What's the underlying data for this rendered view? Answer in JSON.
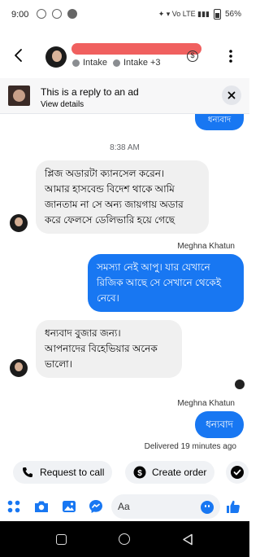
{
  "status_bar": {
    "time": "9:00",
    "battery": "56%",
    "signal_text": "Vo LTE"
  },
  "header": {
    "tags": [
      "Intake",
      "Intake +3"
    ],
    "dollar_symbol": "$"
  },
  "ad_banner": {
    "title": "This is a reply to an ad",
    "link": "View details"
  },
  "messages": {
    "top_partial": "ধন্যবাদ",
    "timestamp": "8:38 AM",
    "m1": "প্লিজ অডারটা ক্যানসেল করেন।\nআমার হাসবেন্ড বিদেশ থাকে আমি\nজানতাম না সে অন্য জায়গায় অডার\nকরে ফেলসে ডেলিভারি হয়ে গেছে",
    "sender1": "Meghna Khatun",
    "m2": "সমস্যা নেই আপু। যার যেখানে\nরিজিক আছে সে সেখানে থেকেই\nনেবে।",
    "m3": "ধন্যবাদ বুজার জন্য।\nআপনাদের বিহেভিয়ার অনেক\nভালো।",
    "sender2": "Meghna Khatun",
    "m4": "ধন্যবাদ",
    "delivered": "Delivered 19 minutes ago"
  },
  "quick_actions": {
    "request_call": "Request to call",
    "create_order": "Create order"
  },
  "composer": {
    "placeholder": "Aa"
  },
  "colors": {
    "accent": "#1877f2",
    "incoming_bubble": "#f0f0f0",
    "redaction": "#f0605f"
  },
  "icons": [
    "back-arrow-icon",
    "dollar-icon",
    "more-options-icon",
    "close-icon",
    "menu-grid-icon",
    "camera-icon",
    "photo-icon",
    "messenger-icon",
    "emoji-icon",
    "thumbs-up-icon",
    "phone-icon",
    "check-icon"
  ]
}
